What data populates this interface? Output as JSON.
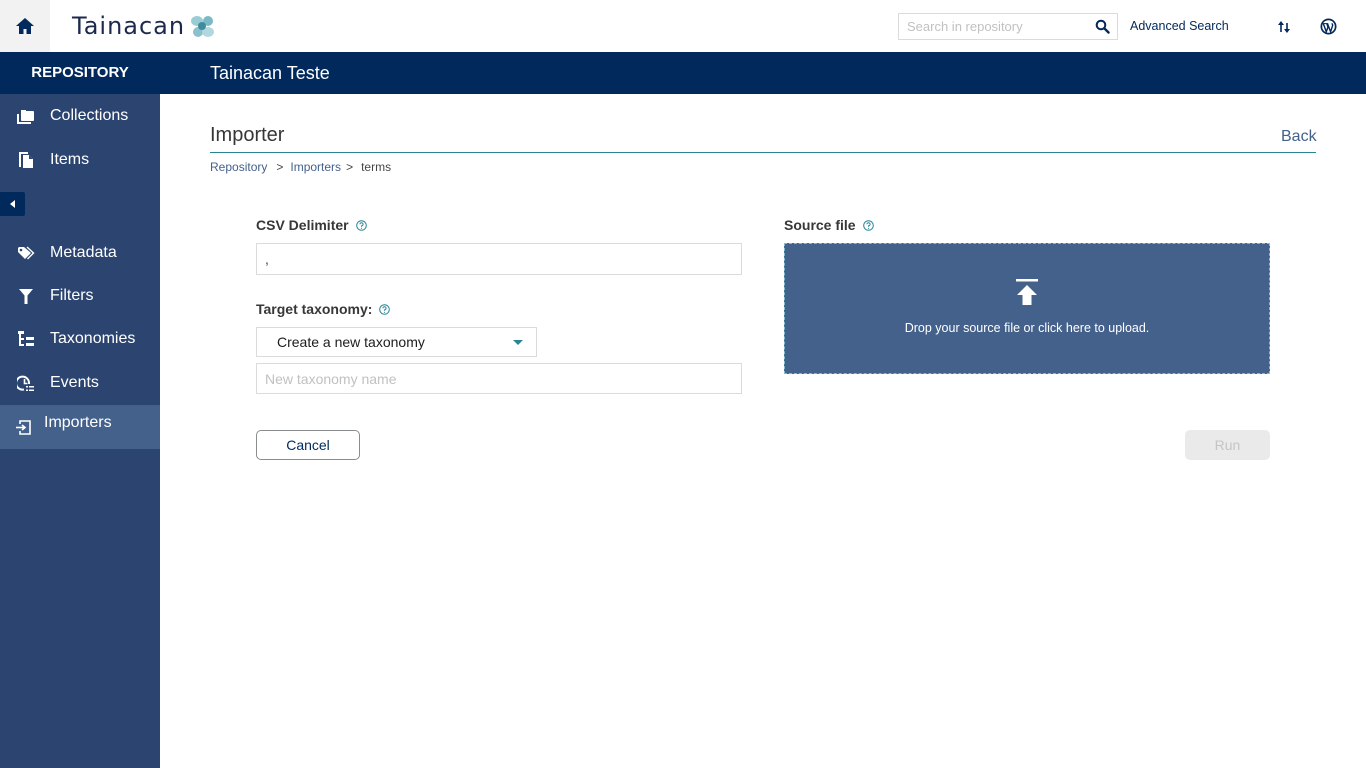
{
  "topbar": {
    "logo_text": "Tainacan",
    "search_placeholder": "Search in repository",
    "search_value": "",
    "advanced_search_label": "Advanced Search",
    "icons": [
      "home-icon",
      "search-icon",
      "sort-arrows-icon",
      "wordpress-icon"
    ]
  },
  "header": {
    "section_label": "REPOSITORY",
    "site_title": "Tainacan Teste"
  },
  "sidebar": {
    "items": [
      {
        "label": "Collections",
        "icon": "collections-icon"
      },
      {
        "label": "Items",
        "icon": "items-icon"
      },
      {
        "label": "Metadata",
        "icon": "tag-icon"
      },
      {
        "label": "Filters",
        "icon": "filter-icon"
      },
      {
        "label": "Taxonomies",
        "icon": "taxonomy-icon"
      },
      {
        "label": "Events",
        "icon": "events-icon"
      },
      {
        "label": "Importers",
        "icon": "importer-icon",
        "active": true
      }
    ],
    "collapse_icon": "caret-left-icon"
  },
  "main": {
    "title": "Importer",
    "back_label": "Back",
    "breadcrumb": [
      {
        "label": "Repository",
        "link": true
      },
      {
        "label": "Importers",
        "link": true
      },
      {
        "label": "terms",
        "link": false
      }
    ],
    "breadcrumb_separator": ">",
    "form": {
      "csv_delimiter_label": "CSV Delimiter",
      "csv_delimiter_value": ",",
      "target_taxonomy_label": "Target taxonomy:",
      "target_taxonomy_selected": "Create a new taxonomy",
      "new_taxonomy_placeholder": "New taxonomy name",
      "new_taxonomy_value": "",
      "source_file_label": "Source file",
      "dropzone_text": "Drop your source file or click here to upload."
    },
    "buttons": {
      "cancel": "Cancel",
      "run": "Run"
    }
  },
  "colors": {
    "primary_dark": "#01295c",
    "sidebar": "#2c4570",
    "sidebar_active": "#44618c",
    "accent_teal": "#298596",
    "link": "#44618c"
  }
}
